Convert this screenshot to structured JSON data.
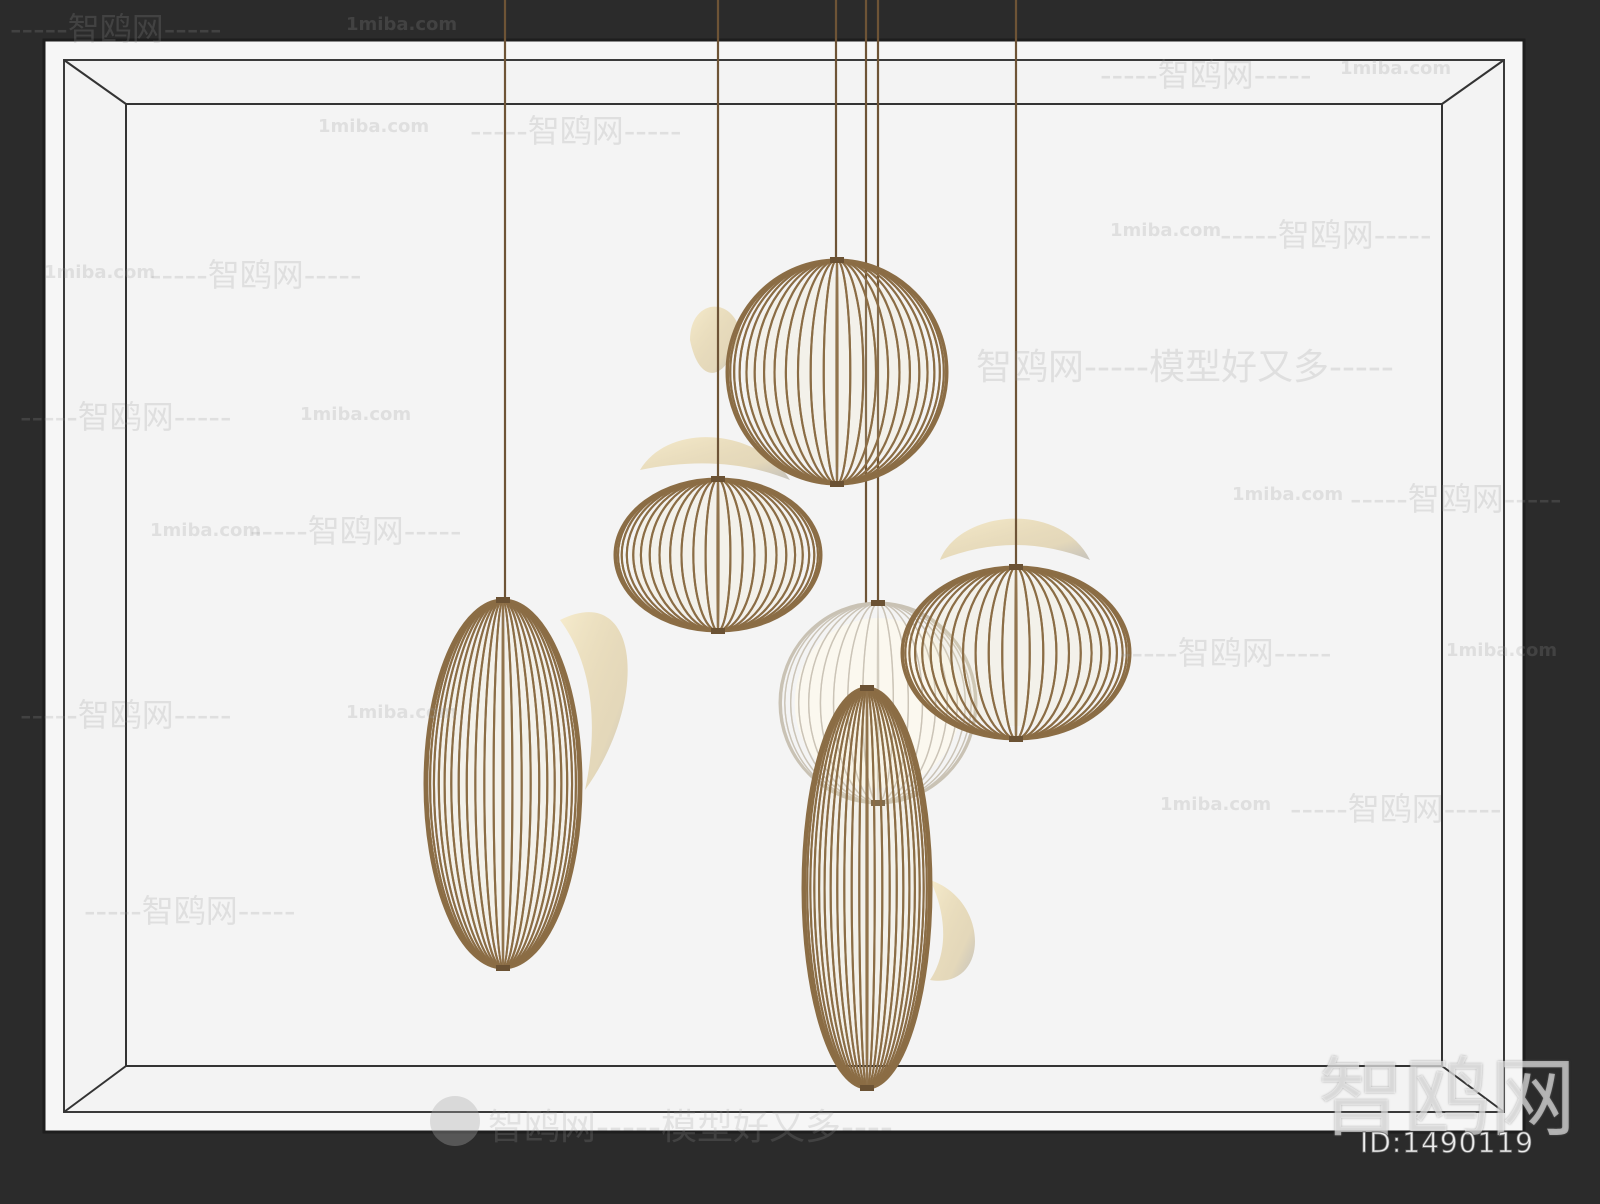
{
  "image": {
    "subject": "pendant-lamp-cluster",
    "colors": {
      "background": "#2b2b2b",
      "frame_outer": "#f4f4f4",
      "frame_line": "#3a3a3a",
      "wire_brass": "#8b6d45",
      "cord": "#6e5436",
      "glow": "#f3e2b3"
    }
  },
  "watermarks": {
    "brand_cn": "智鸥网",
    "site": "1miba.com",
    "dash": "-----",
    "slogan": "智鸥网-----模型好又多----",
    "slogan_mid": "智鸥网-----模型好又多-----",
    "corner_brand": "智鸥网",
    "id_label": "ID:1490119"
  }
}
